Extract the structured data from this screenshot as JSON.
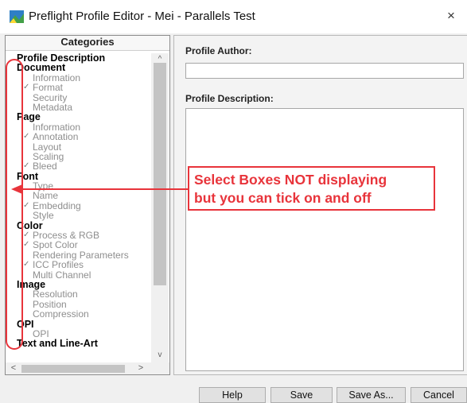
{
  "window": {
    "title": "Preflight Profile Editor - Mei - Parallels Test",
    "close": "×"
  },
  "categories": {
    "header": "Categories",
    "items": [
      {
        "label": "Profile Description",
        "type": "group",
        "checked": false
      },
      {
        "label": "Document",
        "type": "group",
        "checked": false
      },
      {
        "label": "Information",
        "type": "item",
        "checked": false
      },
      {
        "label": "Format",
        "type": "item",
        "checked": true
      },
      {
        "label": "Security",
        "type": "item",
        "checked": false
      },
      {
        "label": "Metadata",
        "type": "item",
        "checked": false
      },
      {
        "label": "Page",
        "type": "group",
        "checked": false
      },
      {
        "label": "Information",
        "type": "item",
        "checked": false
      },
      {
        "label": "Annotation",
        "type": "item",
        "checked": true
      },
      {
        "label": "Layout",
        "type": "item",
        "checked": false
      },
      {
        "label": "Scaling",
        "type": "item",
        "checked": false
      },
      {
        "label": "Bleed",
        "type": "item",
        "checked": true
      },
      {
        "label": "Font",
        "type": "group",
        "checked": false
      },
      {
        "label": "Type",
        "type": "item",
        "checked": false
      },
      {
        "label": "Name",
        "type": "item",
        "checked": false
      },
      {
        "label": "Embedding",
        "type": "item",
        "checked": true
      },
      {
        "label": "Style",
        "type": "item",
        "checked": false
      },
      {
        "label": "Color",
        "type": "group",
        "checked": false
      },
      {
        "label": "Process & RGB",
        "type": "item",
        "checked": true
      },
      {
        "label": "Spot Color",
        "type": "item",
        "checked": true
      },
      {
        "label": "Rendering Parameters",
        "type": "item",
        "checked": false
      },
      {
        "label": "ICC Profiles",
        "type": "item",
        "checked": true
      },
      {
        "label": "Multi Channel",
        "type": "item",
        "checked": false
      },
      {
        "label": "Image",
        "type": "group",
        "checked": false
      },
      {
        "label": "Resolution",
        "type": "item",
        "checked": false
      },
      {
        "label": "Position",
        "type": "item",
        "checked": false
      },
      {
        "label": "Compression",
        "type": "item",
        "checked": false
      },
      {
        "label": "OPI",
        "type": "group",
        "checked": false
      },
      {
        "label": "OPI",
        "type": "item",
        "checked": false
      },
      {
        "label": "Text and Line-Art",
        "type": "group",
        "checked": false
      }
    ]
  },
  "form": {
    "author_label": "Profile Author:",
    "author_value": "",
    "description_label": "Profile Description:",
    "description_value": ""
  },
  "annotation": {
    "line1": "Select Boxes NOT displaying",
    "line2": "but you can tick on and off",
    "color": "#e8343b"
  },
  "buttons": {
    "help": "Help",
    "save": "Save",
    "save_as": "Save As...",
    "cancel": "Cancel"
  },
  "scroll": {
    "up": "^",
    "down": "v",
    "left": "<",
    "right": ">"
  }
}
